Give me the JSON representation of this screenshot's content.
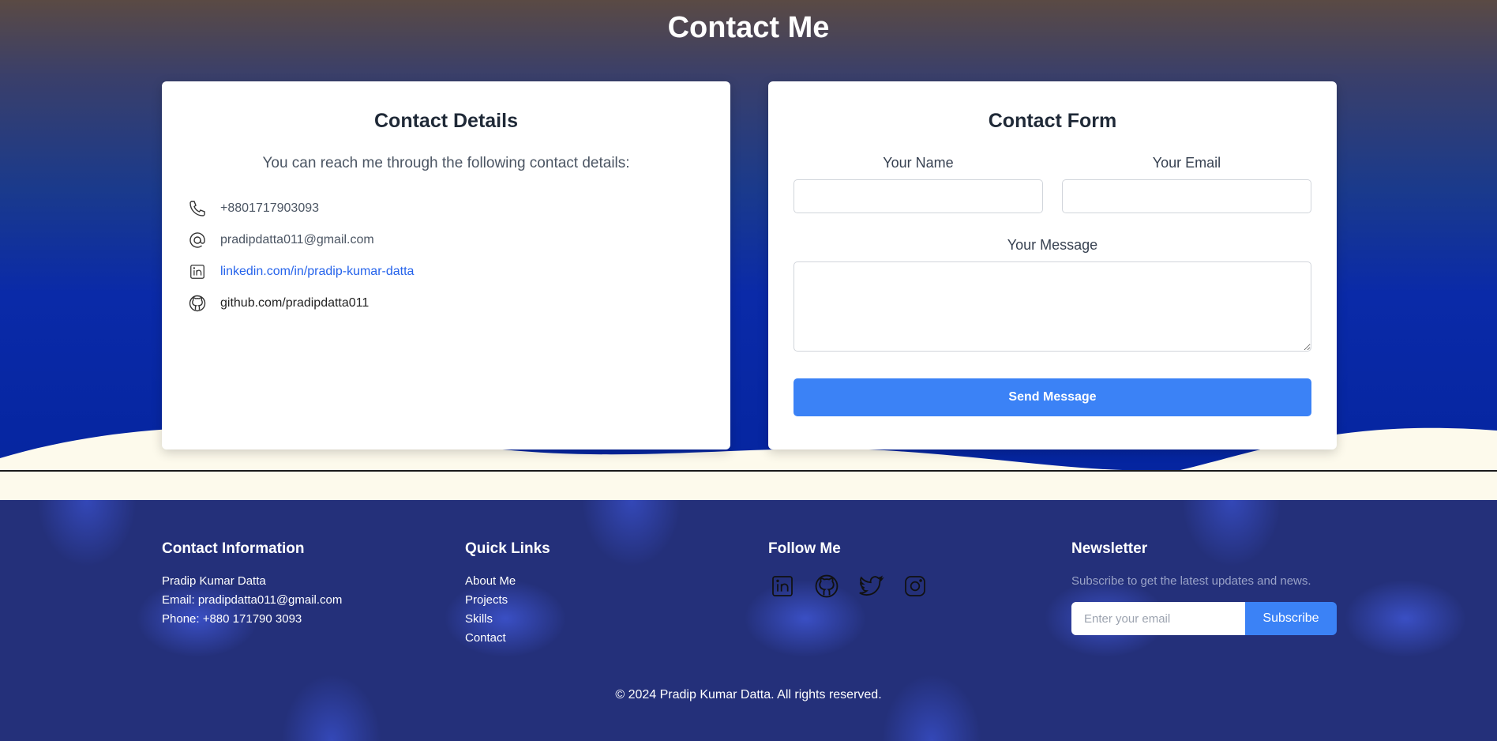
{
  "hero": {
    "title": "Contact Me"
  },
  "contact_details": {
    "title": "Contact Details",
    "subtitle": "You can reach me through the following contact details:",
    "items": [
      {
        "icon": "phone-icon",
        "text": "+8801717903093"
      },
      {
        "icon": "at-icon",
        "text": "pradipdatta011@gmail.com"
      },
      {
        "icon": "linkedin-icon",
        "text": "linkedin.com/in/pradip-kumar-datta"
      },
      {
        "icon": "github-icon",
        "text": "github.com/pradipdatta011"
      }
    ]
  },
  "contact_form": {
    "title": "Contact Form",
    "name_label": "Your Name",
    "email_label": "Your Email",
    "message_label": "Your Message",
    "send_label": "Send Message"
  },
  "footer": {
    "contact": {
      "heading": "Contact Information",
      "name": "Pradip Kumar Datta",
      "email": "Email: pradipdatta011@gmail.com",
      "phone": "Phone: +880 171790 3093"
    },
    "quick_links": {
      "heading": "Quick Links",
      "links": [
        "About Me",
        "Projects",
        "Skills",
        "Contact"
      ]
    },
    "follow": {
      "heading": "Follow Me",
      "icons": [
        "linkedin-icon",
        "github-icon",
        "twitter-icon",
        "instagram-icon"
      ]
    },
    "newsletter": {
      "heading": "Newsletter",
      "text": "Subscribe to get the latest updates and news.",
      "placeholder": "Enter your email",
      "button": "Subscribe"
    },
    "copyright": "© 2024 Pradip Kumar Datta. All rights reserved."
  },
  "colors": {
    "accent": "#3b82f6",
    "link": "#2563eb",
    "hero_bottom": "#0525a0",
    "footer_bg": "#24307a",
    "cream": "#fdfaec"
  }
}
